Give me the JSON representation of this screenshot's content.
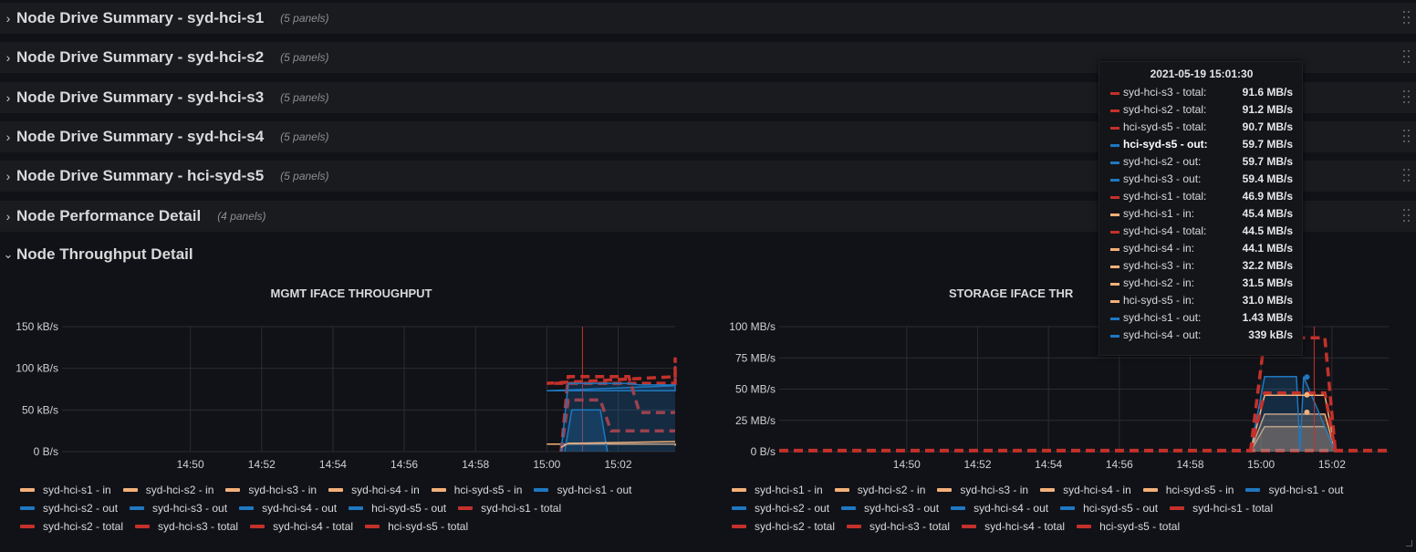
{
  "colors": {
    "in": "#f4b07a",
    "out": "#1f78c1",
    "total": "#c4312a",
    "grid": "#2b2c31",
    "axis": "#cfd0d1",
    "hover": "#c4312a"
  },
  "rows": [
    {
      "title": "Node Drive Summary - syd-hci-s1",
      "count": "(5 panels)",
      "icon": "chevron-right-icon"
    },
    {
      "title": "Node Drive Summary - syd-hci-s2",
      "count": "(5 panels)",
      "icon": "chevron-right-icon"
    },
    {
      "title": "Node Drive Summary - syd-hci-s3",
      "count": "(5 panels)",
      "icon": "chevron-right-icon"
    },
    {
      "title": "Node Drive Summary - syd-hci-s4",
      "count": "(5 panels)",
      "icon": "chevron-right-icon"
    },
    {
      "title": "Node Drive Summary - hci-syd-s5",
      "count": "(5 panels)",
      "icon": "chevron-right-icon"
    },
    {
      "title": "Node Performance Detail",
      "count": "(4 panels)",
      "icon": "chevron-right-icon"
    }
  ],
  "open_row": {
    "title": "Node Throughput Detail",
    "icon": "chevron-down-icon"
  },
  "panels": [
    {
      "title": "MGMT IFACE THROUGHPUT"
    },
    {
      "title": "STORAGE IFACE THR"
    }
  ],
  "legend": [
    {
      "name": "syd-hci-s1 - in",
      "kind": "in"
    },
    {
      "name": "syd-hci-s2 - in",
      "kind": "in"
    },
    {
      "name": "syd-hci-s3 - in",
      "kind": "in"
    },
    {
      "name": "syd-hci-s4 - in",
      "kind": "in"
    },
    {
      "name": "hci-syd-s5 - in",
      "kind": "in"
    },
    {
      "name": "syd-hci-s1 - out",
      "kind": "out"
    },
    {
      "name": "syd-hci-s2 - out",
      "kind": "out"
    },
    {
      "name": "syd-hci-s3 - out",
      "kind": "out"
    },
    {
      "name": "syd-hci-s4 - out",
      "kind": "out"
    },
    {
      "name": "hci-syd-s5 - out",
      "kind": "out"
    },
    {
      "name": "syd-hci-s1 - total",
      "kind": "total"
    },
    {
      "name": "syd-hci-s2 - total",
      "kind": "total"
    },
    {
      "name": "syd-hci-s3 - total",
      "kind": "total"
    },
    {
      "name": "syd-hci-s4 - total",
      "kind": "total"
    },
    {
      "name": "hci-syd-s5 - total",
      "kind": "total"
    }
  ],
  "tooltip": {
    "time": "2021-05-19 15:01:30",
    "rows": [
      {
        "name": "syd-hci-s3 - total:",
        "value": "91.6 MB/s",
        "kind": "total"
      },
      {
        "name": "syd-hci-s2 - total:",
        "value": "91.2 MB/s",
        "kind": "total"
      },
      {
        "name": "hci-syd-s5 - total:",
        "value": "90.7 MB/s",
        "kind": "total"
      },
      {
        "name": "hci-syd-s5 - out:",
        "value": "59.7 MB/s",
        "kind": "out",
        "highlight": true
      },
      {
        "name": "syd-hci-s2 - out:",
        "value": "59.7 MB/s",
        "kind": "out"
      },
      {
        "name": "syd-hci-s3 - out:",
        "value": "59.4 MB/s",
        "kind": "out"
      },
      {
        "name": "syd-hci-s1 - total:",
        "value": "46.9 MB/s",
        "kind": "total"
      },
      {
        "name": "syd-hci-s1 - in:",
        "value": "45.4 MB/s",
        "kind": "in"
      },
      {
        "name": "syd-hci-s4 - total:",
        "value": "44.5 MB/s",
        "kind": "total"
      },
      {
        "name": "syd-hci-s4 - in:",
        "value": "44.1 MB/s",
        "kind": "in"
      },
      {
        "name": "syd-hci-s3 - in:",
        "value": "32.2 MB/s",
        "kind": "in"
      },
      {
        "name": "syd-hci-s2 - in:",
        "value": "31.5 MB/s",
        "kind": "in"
      },
      {
        "name": "hci-syd-s5 - in:",
        "value": "31.0 MB/s",
        "kind": "in"
      },
      {
        "name": "syd-hci-s1 - out:",
        "value": "1.43 MB/s",
        "kind": "out"
      },
      {
        "name": "syd-hci-s4 - out:",
        "value": "339 kB/s",
        "kind": "out"
      }
    ]
  },
  "chart_data": [
    {
      "type": "area",
      "title": "MGMT IFACE THROUGHPUT",
      "x_ticks": [
        "14:50",
        "14:52",
        "14:54",
        "14:56",
        "14:58",
        "15:00",
        "15:02"
      ],
      "y_ticks": [
        "0 B/s",
        "50 kB/s",
        "100 kB/s",
        "150 kB/s"
      ],
      "ylim": [
        0,
        150
      ],
      "y_unit": "kB/s",
      "hover_x": 15.017,
      "x": [
        14.773,
        14.83,
        14.87,
        14.9,
        14.95,
        15.0,
        15.05,
        15.1,
        15.15,
        15.2,
        15.25,
        15.3,
        15.35,
        15.4,
        15.45,
        15.5,
        15.55,
        15.6,
        15.65,
        15.7,
        15.75,
        15.8,
        15.85,
        15.9,
        15.95,
        16.0,
        16.03,
        16.05,
        16.1,
        16.15,
        16.2,
        16.25,
        16.3,
        16.35,
        16.4,
        16.45,
        16.5,
        16.55,
        16.6,
        16.65,
        16.7,
        16.75,
        16.8,
        16.85,
        16.9,
        16.95,
        17.0,
        17.05,
        17.1,
        17.15,
        17.2,
        17.25,
        17.3,
        17.35,
        17.4,
        17.45,
        17.5,
        17.55
      ],
      "series": [
        {
          "name": "syd-hci-s1 - out",
          "kind": "out",
          "fill": true,
          "values": [
            79,
            78,
            78,
            73,
            73,
            73,
            79,
            79,
            79,
            79,
            79,
            79,
            79,
            79,
            79,
            80,
            80,
            80,
            80,
            103,
            103,
            103,
            79,
            79,
            79,
            79,
            79,
            85,
            85,
            85,
            79,
            79,
            79,
            79,
            79,
            79,
            79,
            79,
            79,
            79,
            79,
            79,
            79,
            79,
            79,
            79,
            79,
            79,
            79,
            79,
            79,
            79,
            79,
            79,
            79,
            79,
            79,
            79
          ]
        },
        {
          "name": "syd-hci-s1 - total",
          "kind": "total",
          "fill": false,
          "values": [
            88,
            88,
            88,
            82,
            82,
            82,
            90,
            90,
            90,
            90,
            90,
            90,
            90,
            90,
            90,
            92,
            92,
            92,
            92,
            113,
            113,
            113,
            88,
            88,
            88,
            88,
            88,
            97,
            97,
            97,
            92,
            92,
            92,
            92,
            92,
            92,
            92,
            92,
            92,
            92,
            92,
            92,
            92,
            92,
            92,
            92,
            92,
            92,
            92,
            92,
            92,
            92,
            92,
            92,
            92,
            92,
            92,
            92
          ]
        },
        {
          "name": "syd-hci-s1 - in",
          "kind": "in",
          "fill": false,
          "values": [
            10,
            10,
            10,
            10,
            9,
            9,
            9,
            9,
            9,
            9,
            9,
            9,
            9,
            9,
            9,
            9,
            9,
            9,
            9,
            8,
            8,
            8,
            7,
            7,
            7,
            7,
            7,
            7,
            7,
            7,
            7,
            7,
            7,
            7,
            7,
            7,
            7,
            7,
            7,
            7,
            7,
            7,
            7,
            7,
            7,
            7,
            7,
            7,
            7,
            7,
            7,
            7,
            7,
            7,
            7,
            7,
            7,
            7
          ]
        }
      ]
    },
    {
      "type": "area",
      "title": "STORAGE IFACE THR",
      "x_ticks": [
        "14:50",
        "14:52",
        "14:54",
        "14:56",
        "14:58",
        "15:00",
        "15:02"
      ],
      "y_ticks": [
        "0 B/s",
        "25 MB/s",
        "50 MB/s",
        "75 MB/s",
        "100 MB/s"
      ],
      "ylim": [
        0,
        100
      ],
      "y_unit": "MB/s",
      "hover_x": 15.025
    }
  ]
}
